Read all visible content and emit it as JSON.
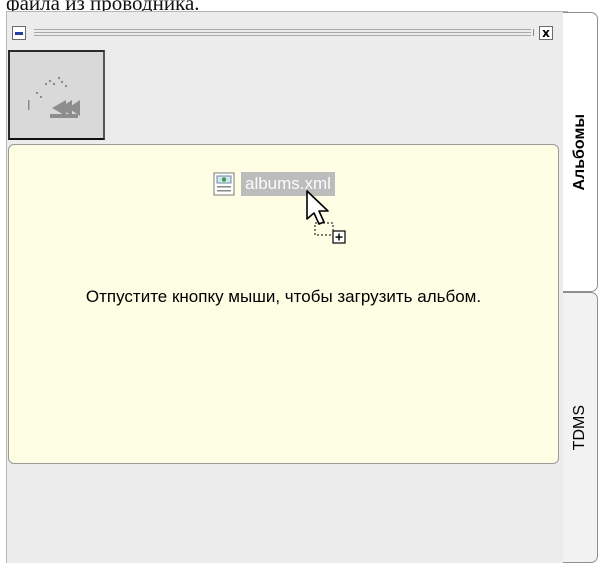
{
  "caption": "файла из проводника.",
  "window": {
    "minimize_icon": "minimize-icon",
    "close_glyph": "x"
  },
  "toolbar": {
    "load_album_icon": "load-album-icon"
  },
  "dropzone": {
    "file_icon": "xml-file-icon",
    "file_name": "albums.xml",
    "message": "Отпустите кнопку мыши, чтобы загрузить альбом.",
    "cursor_icon": "drag-copy-cursor-icon"
  },
  "tabs": [
    {
      "label": "Альбомы",
      "active": true
    },
    {
      "label": "TDMS",
      "active": false
    }
  ],
  "colors": {
    "panel_bg": "#ececec",
    "dropzone_bg": "#fefee5",
    "selection_bg": "#bcbcbc"
  }
}
